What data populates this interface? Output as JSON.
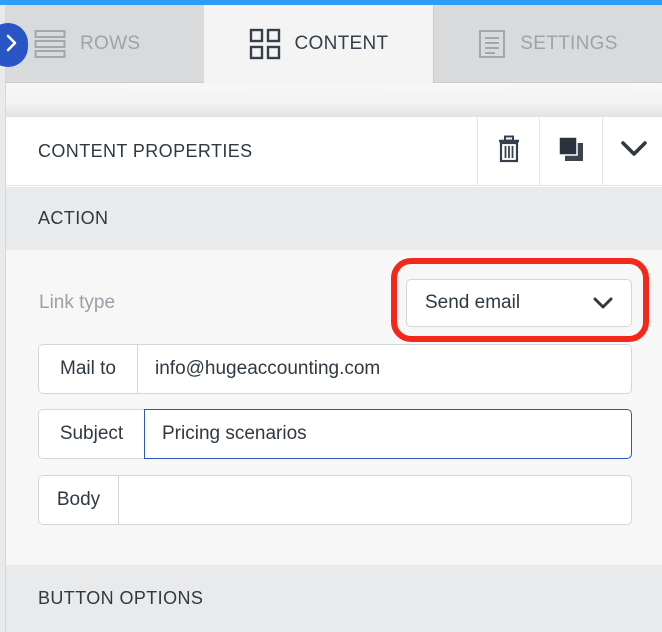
{
  "tabs": {
    "rows": "ROWS",
    "content": "CONTENT",
    "settings": "SETTINGS"
  },
  "panel": {
    "title": "CONTENT PROPERTIES"
  },
  "sections": {
    "action": "ACTION",
    "button_options": "BUTTON OPTIONS"
  },
  "link_type": {
    "label": "Link type",
    "value": "Send email"
  },
  "fields": {
    "mail_to": {
      "label": "Mail to",
      "value": "info@hugeaccounting.com"
    },
    "subject": {
      "label": "Subject",
      "value": "Pricing scenarios"
    },
    "body": {
      "label": "Body",
      "value": ""
    }
  },
  "colors": {
    "accent": "#2f9cf5",
    "collapse_button": "#2a55c4",
    "highlight": "#f4271a",
    "focus_border": "#2e56b8"
  },
  "icons": {
    "rows": "rows-icon",
    "content": "content-grid-icon",
    "settings": "settings-doc-icon",
    "trash": "trash-icon",
    "duplicate": "duplicate-icon",
    "collapse_panel": "chevron-down-icon",
    "select": "chevron-down-icon",
    "sidebar_toggle": "chevron-right-icon"
  }
}
